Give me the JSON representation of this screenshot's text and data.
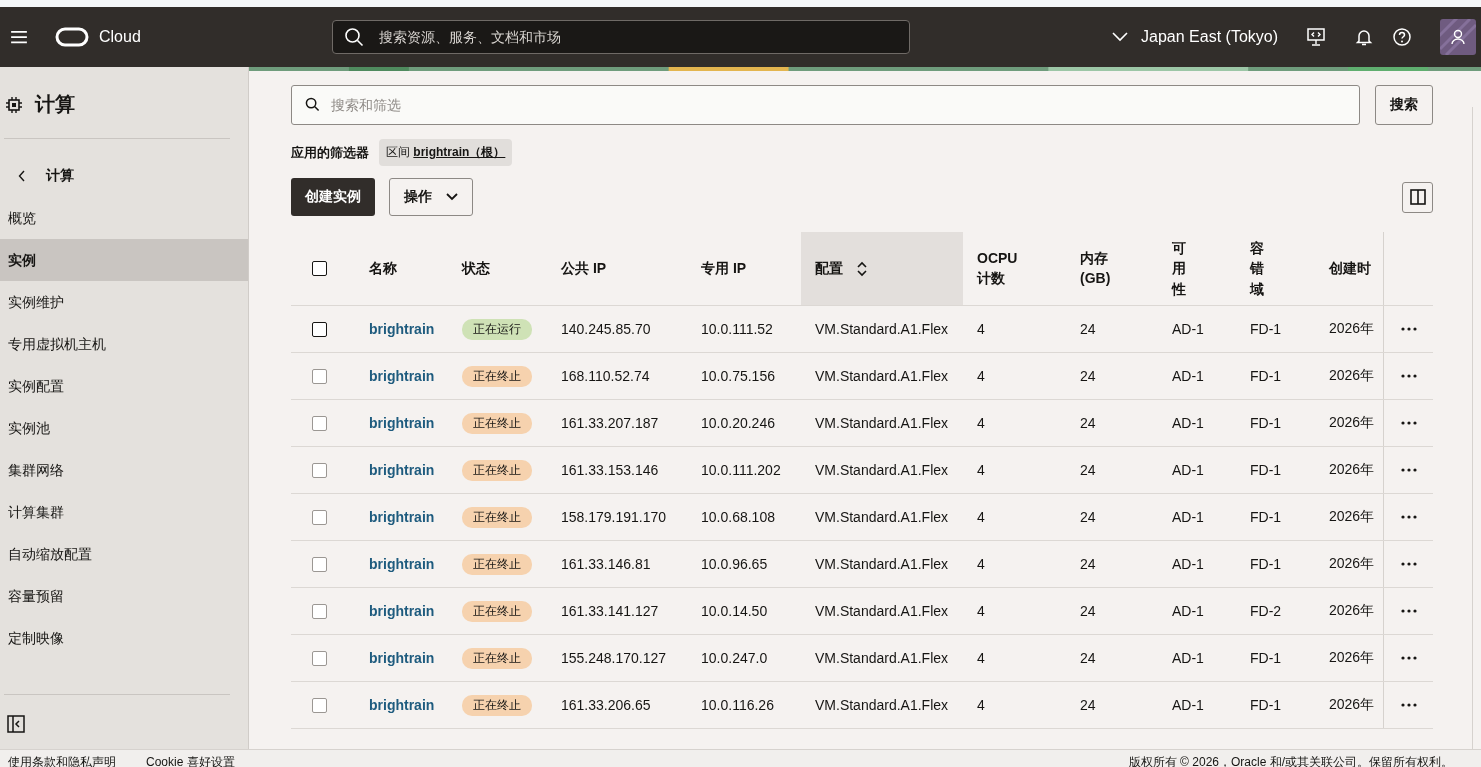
{
  "header": {
    "brand": "Cloud",
    "search_placeholder": "搜索资源、服务、文档和市场",
    "region": "Japan East (Tokyo)"
  },
  "sidebar": {
    "title": "计算",
    "back_label": "计算",
    "items": [
      {
        "label": "概览",
        "selected": false
      },
      {
        "label": "实例",
        "selected": true
      },
      {
        "label": "实例维护",
        "selected": false
      },
      {
        "label": "专用虚拟机主机",
        "selected": false
      },
      {
        "label": "实例配置",
        "selected": false
      },
      {
        "label": "实例池",
        "selected": false
      },
      {
        "label": "集群网络",
        "selected": false
      },
      {
        "label": "计算集群",
        "selected": false
      },
      {
        "label": "自动缩放配置",
        "selected": false
      },
      {
        "label": "容量预留",
        "selected": false
      },
      {
        "label": "定制映像",
        "selected": false
      }
    ]
  },
  "search": {
    "placeholder": "搜索和筛选",
    "button": "搜索"
  },
  "filters": {
    "label": "应用的筛选器",
    "chip_prefix": "区间",
    "chip_value": "brightrain（根）"
  },
  "actions": {
    "create": "创建实例",
    "menu": "操作"
  },
  "table": {
    "select_all_checked": false,
    "columns": [
      {
        "label": "名称",
        "sorted": false
      },
      {
        "label": "状态",
        "sorted": false
      },
      {
        "label": "公共 IP",
        "sorted": false
      },
      {
        "label": "专用 IP",
        "sorted": false
      },
      {
        "label": "配置",
        "sorted": true
      },
      {
        "label": "OCPU 计数",
        "sorted": false
      },
      {
        "label": "内存 (GB)",
        "sorted": false
      },
      {
        "label": "可用性",
        "sorted": false,
        "vertical": true
      },
      {
        "label": "容错域",
        "sorted": false,
        "vertical": true
      },
      {
        "label": "创建时",
        "sorted": false
      }
    ],
    "rows": [
      {
        "checked": false,
        "name": "brightrain",
        "status": {
          "label": "正在运行",
          "kind": "running"
        },
        "public_ip": "140.245.85.70",
        "private_ip": "10.0.111.52",
        "shape": "VM.Standard.A1.Flex",
        "ocpu": "4",
        "memory": "24",
        "ad": "AD-1",
        "fd": "FD-1",
        "created": "2026年"
      },
      {
        "checked": false,
        "name": "brightrain",
        "status": {
          "label": "正在终止",
          "kind": "terminating"
        },
        "public_ip": "168.110.52.74",
        "private_ip": "10.0.75.156",
        "shape": "VM.Standard.A1.Flex",
        "ocpu": "4",
        "memory": "24",
        "ad": "AD-1",
        "fd": "FD-1",
        "created": "2026年"
      },
      {
        "checked": false,
        "name": "brightrain",
        "status": {
          "label": "正在终止",
          "kind": "terminating"
        },
        "public_ip": "161.33.207.187",
        "private_ip": "10.0.20.246",
        "shape": "VM.Standard.A1.Flex",
        "ocpu": "4",
        "memory": "24",
        "ad": "AD-1",
        "fd": "FD-1",
        "created": "2026年"
      },
      {
        "checked": false,
        "name": "brightrain",
        "status": {
          "label": "正在终止",
          "kind": "terminating"
        },
        "public_ip": "161.33.153.146",
        "private_ip": "10.0.111.202",
        "shape": "VM.Standard.A1.Flex",
        "ocpu": "4",
        "memory": "24",
        "ad": "AD-1",
        "fd": "FD-1",
        "created": "2026年"
      },
      {
        "checked": false,
        "name": "brightrain",
        "status": {
          "label": "正在终止",
          "kind": "terminating"
        },
        "public_ip": "158.179.191.170",
        "private_ip": "10.0.68.108",
        "shape": "VM.Standard.A1.Flex",
        "ocpu": "4",
        "memory": "24",
        "ad": "AD-1",
        "fd": "FD-1",
        "created": "2026年"
      },
      {
        "checked": false,
        "name": "brightrain",
        "status": {
          "label": "正在终止",
          "kind": "terminating"
        },
        "public_ip": "161.33.146.81",
        "private_ip": "10.0.96.65",
        "shape": "VM.Standard.A1.Flex",
        "ocpu": "4",
        "memory": "24",
        "ad": "AD-1",
        "fd": "FD-1",
        "created": "2026年"
      },
      {
        "checked": false,
        "name": "brightrain",
        "status": {
          "label": "正在终止",
          "kind": "terminating"
        },
        "public_ip": "161.33.141.127",
        "private_ip": "10.0.14.50",
        "shape": "VM.Standard.A1.Flex",
        "ocpu": "4",
        "memory": "24",
        "ad": "AD-1",
        "fd": "FD-2",
        "created": "2026年"
      },
      {
        "checked": false,
        "name": "brightrain",
        "status": {
          "label": "正在终止",
          "kind": "terminating"
        },
        "public_ip": "155.248.170.127",
        "private_ip": "10.0.247.0",
        "shape": "VM.Standard.A1.Flex",
        "ocpu": "4",
        "memory": "24",
        "ad": "AD-1",
        "fd": "FD-1",
        "created": "2026年"
      },
      {
        "checked": false,
        "name": "brightrain",
        "status": {
          "label": "正在终止",
          "kind": "terminating"
        },
        "public_ip": "161.33.206.65",
        "private_ip": "10.0.116.26",
        "shape": "VM.Standard.A1.Flex",
        "ocpu": "4",
        "memory": "24",
        "ad": "AD-1",
        "fd": "FD-1",
        "created": "2026年"
      }
    ]
  },
  "footer": {
    "links": [
      "使用条款和隐私声明",
      "Cookie 喜好设置"
    ],
    "copyright": "版权所有 © 2026，Oracle 和/或其关联公司。保留所有权利。"
  }
}
